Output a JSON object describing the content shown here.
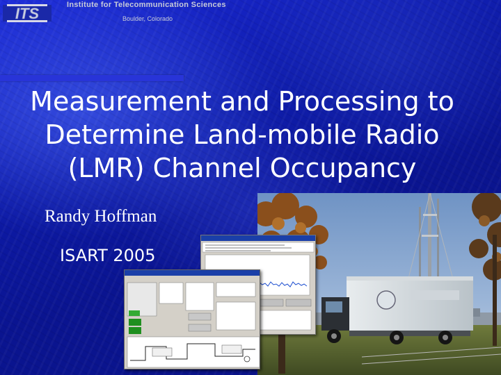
{
  "header": {
    "logo_text": "ITS",
    "institute": "Institute for Telecommunication Sciences",
    "location": "Boulder, Colorado"
  },
  "slide": {
    "title_lines": [
      "Measurement and Processing to",
      "Determine Land-mobile Radio",
      "(LMR) Channel Occupancy"
    ],
    "author": "Randy Hoffman",
    "conference": "ISART 2005"
  },
  "colors": {
    "background": "#0d1aa8",
    "accent_bar": "#2834d8",
    "title_text": "#ffffff",
    "header_text": "#c8ccd8"
  },
  "images": {
    "photo": "lmr-measurement-truck-with-antenna-mast-photo",
    "screenshot_back": "spectrum-plot-software-window",
    "screenshot_front": "measurement-control-software-window"
  }
}
